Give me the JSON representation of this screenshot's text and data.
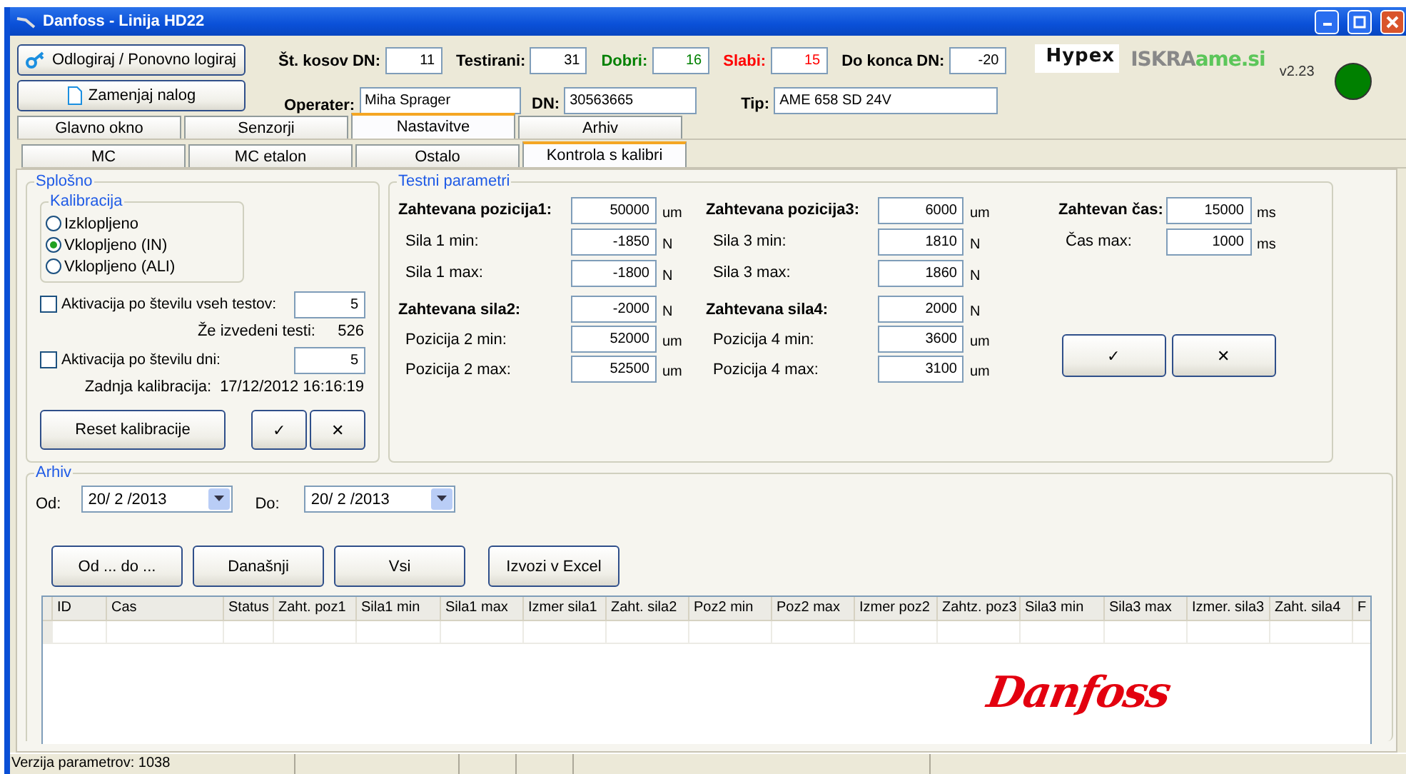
{
  "window": {
    "title": "Danfoss - Linija HD22"
  },
  "header": {
    "buttons": [
      {
        "label": "Odlogiraj / Ponovno logiraj",
        "kind": "key"
      },
      {
        "label": "Zamenjaj nalog",
        "kind": "doc"
      }
    ],
    "stats": [
      {
        "label": "Št. kosov DN:",
        "value": "11",
        "color": "#000000"
      },
      {
        "label": "Testirani:",
        "value": "31",
        "color": "#000000"
      },
      {
        "label": "Dobri:",
        "value": "16",
        "color": "#008000"
      },
      {
        "label": "Slabi:",
        "value": "15",
        "color": "#ff0000"
      },
      {
        "label": "Do konca DN:",
        "value": "-20",
        "color": "#000000"
      }
    ],
    "info": [
      {
        "label": "Operater:",
        "value": "Miha Sprager"
      },
      {
        "label": "DN:",
        "value": "30563665"
      },
      {
        "label": "Tip:",
        "value": "AME 658 SD 24V"
      }
    ],
    "logos": {
      "hypex": "Hypex",
      "iskra": "ISKRA",
      "ame": "ame.si"
    },
    "version": "v2.23",
    "status_lamp": {
      "color": "#008000"
    }
  },
  "tabs": [
    {
      "label": "Glavno okno",
      "selected": false
    },
    {
      "label": "Senzorji",
      "selected": false
    },
    {
      "label": "Nastavitve",
      "selected": true
    },
    {
      "label": "Arhiv",
      "selected": false
    }
  ],
  "subtabs": [
    {
      "label": "MC",
      "selected": false
    },
    {
      "label": "MC etalon",
      "selected": false
    },
    {
      "label": "Ostalo",
      "selected": false
    },
    {
      "label": "Kontrola s kalibri",
      "selected": true
    }
  ],
  "splosno": {
    "title": "Splošno",
    "kalibracija": {
      "title": "Kalibracija",
      "options": [
        {
          "label": "Izklopljeno",
          "selected": false
        },
        {
          "label": "Vklopljeno (IN)",
          "selected": true
        },
        {
          "label": "Vklopljeno (ALI)",
          "selected": false
        }
      ]
    },
    "activations": [
      {
        "label": "Aktivacija po številu vseh testov:",
        "checked": false,
        "value": "5",
        "info_label": "Že izvedeni testi:",
        "info_value": "526"
      },
      {
        "label": "Aktivacija po številu dni:",
        "checked": false,
        "value": "5",
        "info_label": "Zadnja kalibracija:",
        "info_value": "17/12/2012 16:16:19"
      }
    ],
    "reset_button": "Reset kalibracije",
    "ok_button": "✓",
    "cancel_button": "✕"
  },
  "testni_parametri": {
    "title": "Testni parametri",
    "columns": [
      [
        {
          "kind": "heading",
          "label": "Zahtevana pozicija1:",
          "value": "50000",
          "unit": "um"
        },
        {
          "kind": "sub",
          "label": "Sila 1 min:",
          "value": "-1850",
          "unit": "N"
        },
        {
          "kind": "sub",
          "label": "Sila 1 max:",
          "value": "-1800",
          "unit": "N"
        },
        {
          "kind": "heading",
          "label": "Zahtevana sila2:",
          "value": "-2000",
          "unit": "N"
        },
        {
          "kind": "sub",
          "label": "Pozicija 2 min:",
          "value": "52000",
          "unit": "um"
        },
        {
          "kind": "sub",
          "label": "Pozicija 2 max:",
          "value": "52500",
          "unit": "um"
        }
      ],
      [
        {
          "kind": "heading",
          "label": "Zahtevana pozicija3:",
          "value": "6000",
          "unit": "um"
        },
        {
          "kind": "sub",
          "label": "Sila 3 min:",
          "value": "1810",
          "unit": "N"
        },
        {
          "kind": "sub",
          "label": "Sila 3 max:",
          "value": "1860",
          "unit": "N"
        },
        {
          "kind": "heading",
          "label": "Zahtevana sila4:",
          "value": "2000",
          "unit": "N"
        },
        {
          "kind": "sub",
          "label": "Pozicija 4 min:",
          "value": "3600",
          "unit": "um"
        },
        {
          "kind": "sub",
          "label": "Pozicija 4 max:",
          "value": "3100",
          "unit": "um"
        }
      ],
      [
        {
          "kind": "heading",
          "label": "Zahtevan čas:",
          "value": "15000",
          "unit": "ms"
        },
        {
          "kind": "sub",
          "label": "Čas max:",
          "value": "1000",
          "unit": "ms"
        }
      ]
    ],
    "ok_button": "✓",
    "cancel_button": "✕"
  },
  "arhiv": {
    "title": "Arhiv",
    "from_label": "Od:",
    "from_value": "20/ 2 /2013",
    "to_label": "Do:",
    "to_value": "20/ 2 /2013",
    "buttons": [
      "Od ... do ...",
      "Današnji",
      "Vsi",
      "Izvozi v Excel"
    ],
    "table": {
      "columns": [
        "ID",
        "Cas",
        "Status",
        "Zaht. poz1",
        "Sila1 min",
        "Sila1 max",
        "Izmer sila1",
        "Zaht. sila2",
        "Poz2 min",
        "Poz2 max",
        "Izmer poz2",
        "Zahtz. poz3",
        "Sila3 min",
        "Sila3 max",
        "Izmer. sila3",
        "Zaht. sila4",
        "F"
      ]
    },
    "logo": "Danfoss"
  },
  "status_bar": {
    "text": "Verzija parametrov: 1038"
  }
}
